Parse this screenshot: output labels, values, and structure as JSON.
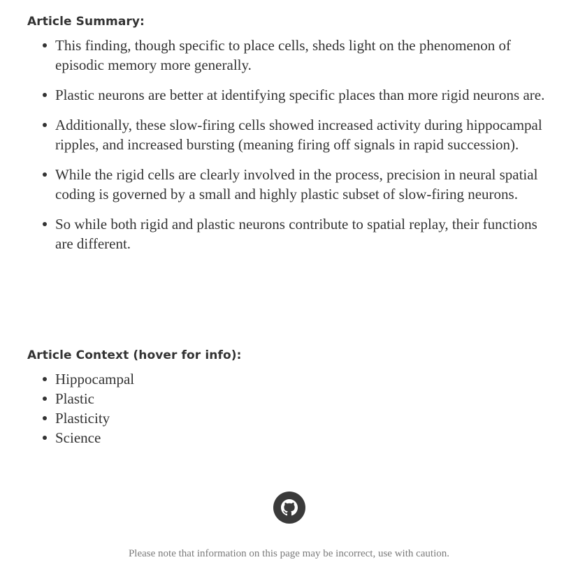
{
  "summary": {
    "heading": "Article Summary:",
    "items": [
      {
        "text": "This finding, though specific to place cells, sheds light on the phenomenon of episodic memory more generally."
      },
      {
        "text": "Plastic neurons are better at identifying specific places than more rigid neurons are."
      },
      {
        "text": "Additionally, these slow-firing cells showed increased activity during hippocampal ripples, and increased bursting (meaning firing off signals in rapid succession)."
      },
      {
        "text": "While the rigid cells are clearly involved in the process, precision in neural spatial coding is governed by a small and highly plastic subset of slow-firing neurons."
      },
      {
        "text": "So while both rigid and plastic neurons contribute to spatial replay, their functions are different."
      }
    ]
  },
  "context": {
    "heading": "Article Context (hover for info):",
    "items": [
      {
        "text": "Hippocampal"
      },
      {
        "text": "Plastic"
      },
      {
        "text": "Plasticity"
      },
      {
        "text": "Science"
      }
    ]
  },
  "footer": {
    "icon": "github-icon",
    "icon_color": "#3a3a3a",
    "disclaimer": "Please note that information on this page may be incorrect, use with caution."
  }
}
